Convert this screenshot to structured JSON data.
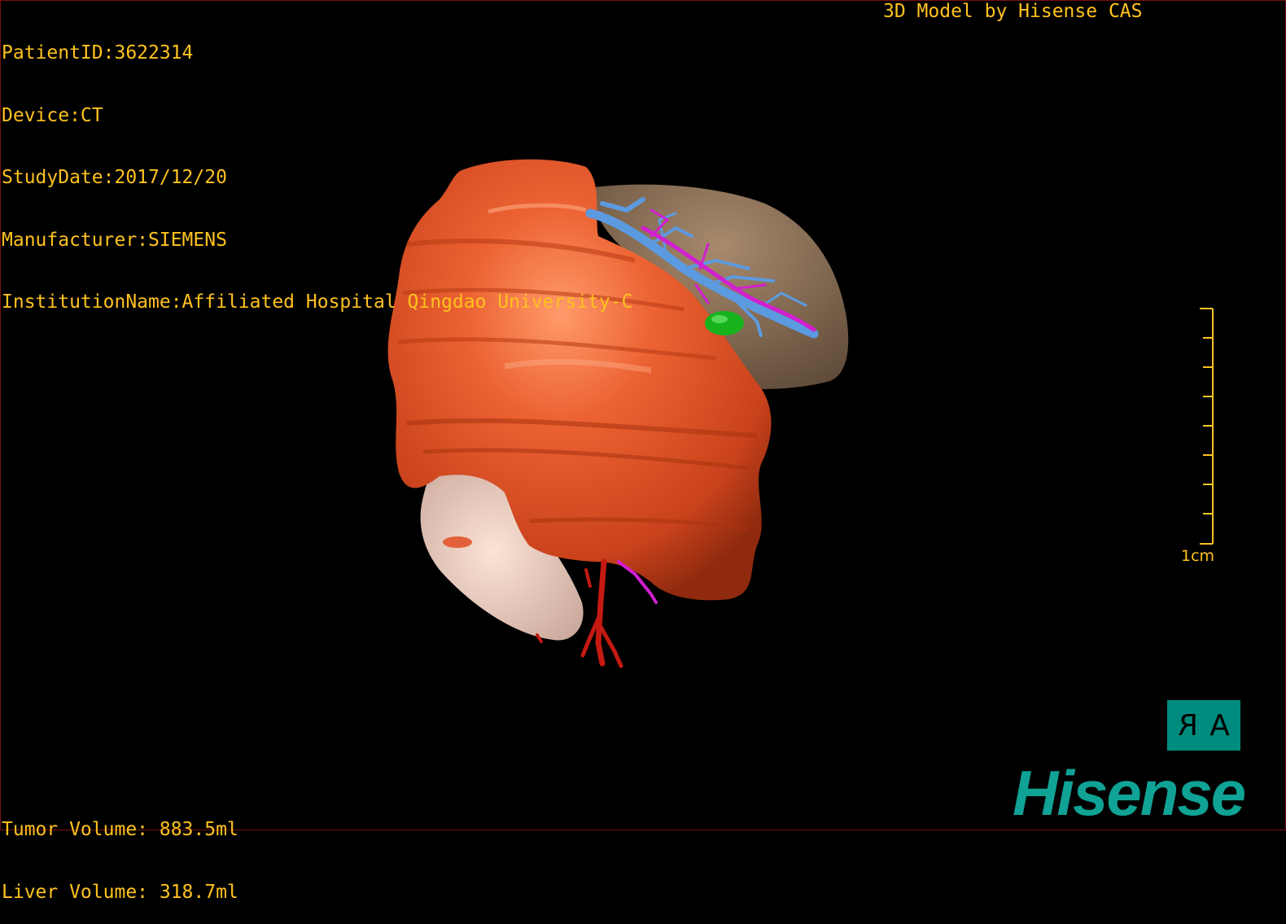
{
  "header": {
    "patient_id": "PatientID:3622314",
    "device": "Device:CT",
    "study_date": "StudyDate:2017/12/20",
    "manufacturer": "Manufacturer:SIEMENS",
    "institution": "InstitutionName:Affiliated Hospital Qingdao University-C"
  },
  "credit": "3D Model by Hisense CAS",
  "volumes": {
    "tumor": "Tumor Volume: 883.5ml",
    "liver": "Liver Volume: 318.7ml"
  },
  "scale": {
    "label": "1cm",
    "ticks": 9
  },
  "orientation": {
    "left_letter": "R",
    "right_letter": "A"
  },
  "logo": "Hisense",
  "colors": {
    "text": "#ffc21f",
    "tumor": "#e45a2c",
    "liver": "#8a6e55",
    "portal_vein": "#5c9ae0",
    "hepatic_vein": "#d21fd0",
    "gallbladder": "#18b21c",
    "artery": "#c41a12",
    "kidney": "#f0cdbd",
    "brand": "#0fa295"
  },
  "structures": [
    "tumor",
    "liver",
    "portal-vein",
    "hepatic-vein",
    "gallbladder",
    "artery",
    "kidney"
  ]
}
